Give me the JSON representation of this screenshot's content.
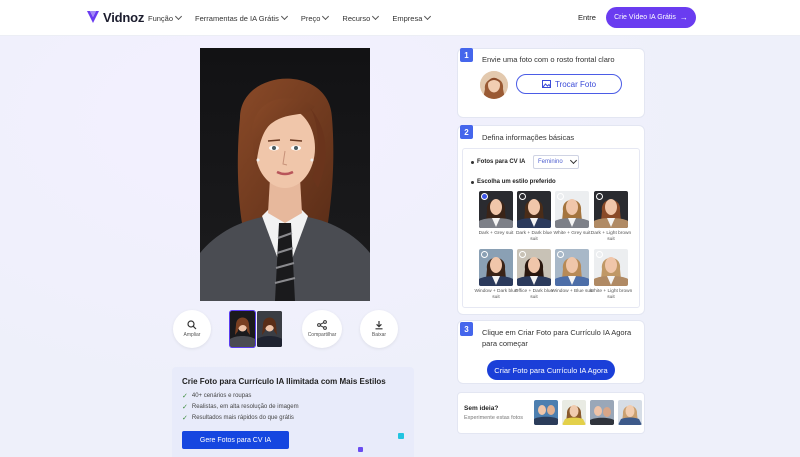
{
  "brand": {
    "logo_text": "Vidnoz",
    "accent": "#6a3cf0",
    "step_blue": "#4566ec"
  },
  "nav": {
    "items": [
      {
        "label": "Função"
      },
      {
        "label": "Ferramentas de IA Grátis"
      },
      {
        "label": "Preço"
      },
      {
        "label": "Recurso"
      },
      {
        "label": "Empresa"
      }
    ],
    "login_label": "Entre",
    "cta_label": "Crie Vídeo IA Grátis"
  },
  "preview_tools": {
    "zoom_label": "Ampliar",
    "share_label": "Compartilhar",
    "download_label": "Baixar"
  },
  "promo": {
    "title": "Crie Foto para Currículo IA Ilimitada com Mais Estilos",
    "features": [
      "40+ cenários e roupas",
      "Realistas, em alta resolução de imagem",
      "Resultados mais rápidos do que grátis"
    ],
    "button_label": "Gere Fotos para CV IA"
  },
  "steps": {
    "step1": {
      "number": "1",
      "title": "Envie uma foto com o rosto frontal claro",
      "button_label": "Trocar Foto"
    },
    "step2": {
      "number": "2",
      "title": "Defina informações básicas",
      "gender_label": "Fotos para CV IA",
      "gender_value": "Feminino",
      "style_label": "Escolha um estilo preferido",
      "styles": [
        {
          "label": "Dark + Grey suit",
          "selected": true
        },
        {
          "label": "Dark + Dark blue suit",
          "selected": false
        },
        {
          "label": "White + Grey suit",
          "selected": false
        },
        {
          "label": "Dark + Light brown suit",
          "selected": false
        },
        {
          "label": "Window + Dark blue suit",
          "selected": false
        },
        {
          "label": "Office + Dark blue suit",
          "selected": false
        },
        {
          "label": "Window + Blue suit",
          "selected": false
        },
        {
          "label": "White + Light brown suit",
          "selected": false
        }
      ]
    },
    "step3": {
      "number": "3",
      "text_line1": "Clique em Criar Foto para Currículo IA Agora",
      "text_line2": "para começar",
      "button_label": "Criar Foto para Currículo IA Agora"
    }
  },
  "ideas": {
    "title": "Sem ideia?",
    "subtitle": "Experimente estas fotos"
  }
}
